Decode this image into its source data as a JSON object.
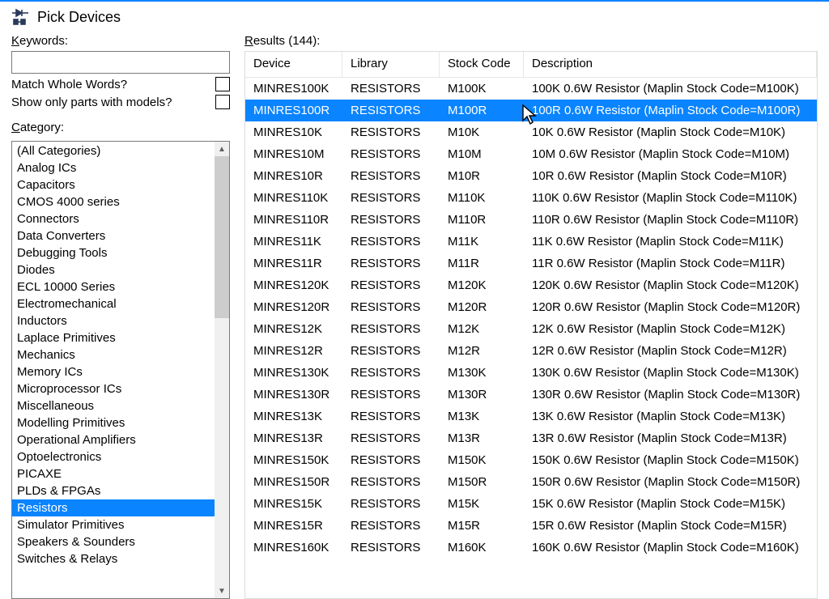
{
  "window": {
    "title": "Pick Devices"
  },
  "left": {
    "keywords_label": "Keywords:",
    "keywords_underline": "K",
    "keywords_value": "",
    "match_whole_label": "Match Whole Words?",
    "show_only_models_label": "Show only parts with models?",
    "category_label": "Category:",
    "category_underline": "C",
    "categories": [
      "(All Categories)",
      "Analog ICs",
      "Capacitors",
      "CMOS 4000 series",
      "Connectors",
      "Data Converters",
      "Debugging Tools",
      "Diodes",
      "ECL 10000 Series",
      "Electromechanical",
      "Inductors",
      "Laplace Primitives",
      "Mechanics",
      "Memory ICs",
      "Microprocessor ICs",
      "Miscellaneous",
      "Modelling Primitives",
      "Operational Amplifiers",
      "Optoelectronics",
      "PICAXE",
      "PLDs & FPGAs",
      "Resistors",
      "Simulator Primitives",
      "Speakers & Sounders",
      "Switches & Relays"
    ],
    "selected_category_index": 21
  },
  "results": {
    "label_prefix": "Results (144):",
    "label_underline": "R",
    "columns": [
      "Device",
      "Library",
      "Stock Code",
      "Description"
    ],
    "selected_index": 1,
    "rows": [
      {
        "device": "MINRES100K",
        "library": "RESISTORS",
        "stock": "M100K",
        "desc": "100K 0.6W Resistor (Maplin Stock Code=M100K)"
      },
      {
        "device": "MINRES100R",
        "library": "RESISTORS",
        "stock": "M100R",
        "desc": "100R 0.6W Resistor (Maplin Stock Code=M100R)"
      },
      {
        "device": "MINRES10K",
        "library": "RESISTORS",
        "stock": "M10K",
        "desc": "10K 0.6W Resistor (Maplin Stock Code=M10K)"
      },
      {
        "device": "MINRES10M",
        "library": "RESISTORS",
        "stock": "M10M",
        "desc": "10M 0.6W Resistor (Maplin Stock Code=M10M)"
      },
      {
        "device": "MINRES10R",
        "library": "RESISTORS",
        "stock": "M10R",
        "desc": "10R 0.6W Resistor (Maplin Stock Code=M10R)"
      },
      {
        "device": "MINRES110K",
        "library": "RESISTORS",
        "stock": "M110K",
        "desc": "110K 0.6W Resistor (Maplin Stock Code=M110K)"
      },
      {
        "device": "MINRES110R",
        "library": "RESISTORS",
        "stock": "M110R",
        "desc": "110R 0.6W Resistor (Maplin Stock Code=M110R)"
      },
      {
        "device": "MINRES11K",
        "library": "RESISTORS",
        "stock": "M11K",
        "desc": "11K 0.6W Resistor (Maplin Stock Code=M11K)"
      },
      {
        "device": "MINRES11R",
        "library": "RESISTORS",
        "stock": "M11R",
        "desc": "11R 0.6W Resistor (Maplin Stock Code=M11R)"
      },
      {
        "device": "MINRES120K",
        "library": "RESISTORS",
        "stock": "M120K",
        "desc": "120K 0.6W Resistor (Maplin Stock Code=M120K)"
      },
      {
        "device": "MINRES120R",
        "library": "RESISTORS",
        "stock": "M120R",
        "desc": "120R 0.6W Resistor (Maplin Stock Code=M120R)"
      },
      {
        "device": "MINRES12K",
        "library": "RESISTORS",
        "stock": "M12K",
        "desc": "12K 0.6W Resistor (Maplin Stock Code=M12K)"
      },
      {
        "device": "MINRES12R",
        "library": "RESISTORS",
        "stock": "M12R",
        "desc": "12R 0.6W Resistor (Maplin Stock Code=M12R)"
      },
      {
        "device": "MINRES130K",
        "library": "RESISTORS",
        "stock": "M130K",
        "desc": "130K 0.6W Resistor (Maplin Stock Code=M130K)"
      },
      {
        "device": "MINRES130R",
        "library": "RESISTORS",
        "stock": "M130R",
        "desc": "130R 0.6W Resistor (Maplin Stock Code=M130R)"
      },
      {
        "device": "MINRES13K",
        "library": "RESISTORS",
        "stock": "M13K",
        "desc": "13K 0.6W Resistor (Maplin Stock Code=M13K)"
      },
      {
        "device": "MINRES13R",
        "library": "RESISTORS",
        "stock": "M13R",
        "desc": "13R 0.6W Resistor (Maplin Stock Code=M13R)"
      },
      {
        "device": "MINRES150K",
        "library": "RESISTORS",
        "stock": "M150K",
        "desc": "150K 0.6W Resistor (Maplin Stock Code=M150K)"
      },
      {
        "device": "MINRES150R",
        "library": "RESISTORS",
        "stock": "M150R",
        "desc": "150R 0.6W Resistor (Maplin Stock Code=M150R)"
      },
      {
        "device": "MINRES15K",
        "library": "RESISTORS",
        "stock": "M15K",
        "desc": "15K 0.6W Resistor (Maplin Stock Code=M15K)"
      },
      {
        "device": "MINRES15R",
        "library": "RESISTORS",
        "stock": "M15R",
        "desc": "15R 0.6W Resistor (Maplin Stock Code=M15R)"
      },
      {
        "device": "MINRES160K",
        "library": "RESISTORS",
        "stock": "M160K",
        "desc": "160K 0.6W Resistor (Maplin Stock Code=M160K)"
      }
    ]
  }
}
